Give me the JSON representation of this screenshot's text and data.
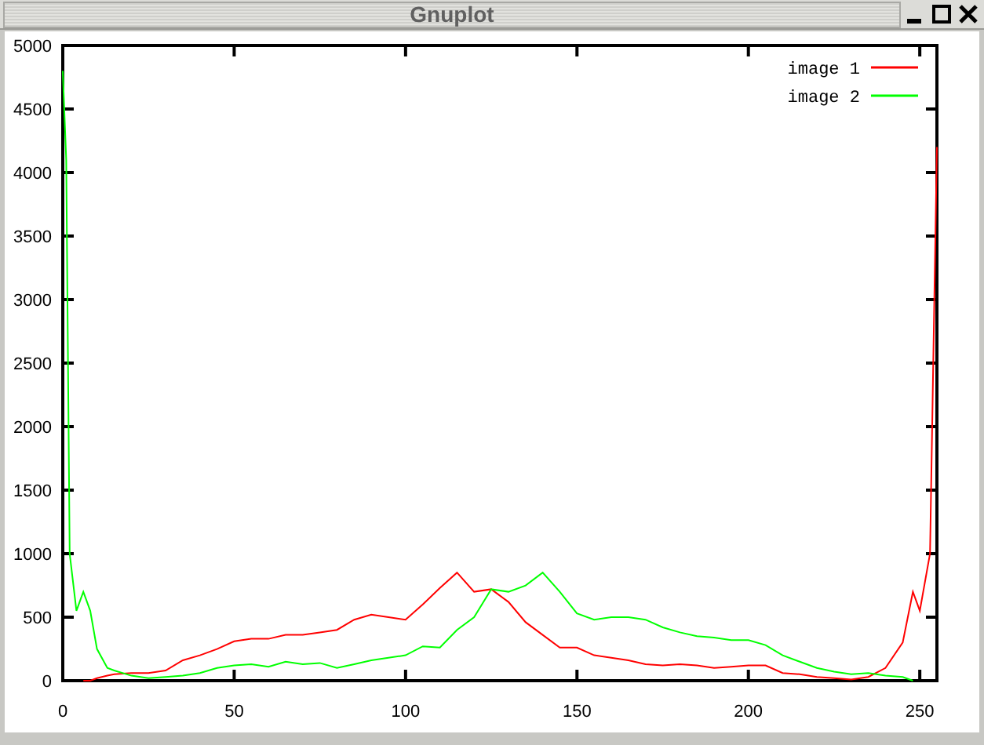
{
  "window": {
    "title": "Gnuplot"
  },
  "chart": {
    "chart_data": {
      "type": "line",
      "legend": "top right",
      "xlim": [
        0,
        255
      ],
      "ylim": [
        0,
        5000
      ],
      "xticks": [
        0,
        50,
        100,
        150,
        200,
        250
      ],
      "yticks": [
        0,
        500,
        1000,
        1500,
        2000,
        2500,
        3000,
        3500,
        4000,
        4500,
        5000
      ],
      "x": [
        0,
        1,
        2,
        4,
        6,
        8,
        10,
        13,
        15,
        20,
        25,
        30,
        35,
        40,
        45,
        50,
        55,
        60,
        65,
        70,
        75,
        80,
        85,
        90,
        95,
        100,
        105,
        110,
        115,
        120,
        125,
        130,
        135,
        140,
        145,
        150,
        155,
        160,
        165,
        170,
        175,
        180,
        185,
        190,
        195,
        200,
        205,
        210,
        215,
        220,
        225,
        230,
        235,
        240,
        245,
        248,
        250,
        253,
        255
      ],
      "series": [
        {
          "name": "image 1",
          "color": "#ff0000",
          "values": [
            null,
            null,
            null,
            null,
            0,
            0,
            20,
            40,
            50,
            60,
            60,
            80,
            160,
            200,
            250,
            310,
            330,
            330,
            360,
            360,
            380,
            400,
            480,
            520,
            500,
            480,
            600,
            730,
            850,
            700,
            720,
            620,
            460,
            360,
            260,
            260,
            200,
            180,
            160,
            130,
            120,
            130,
            120,
            100,
            110,
            120,
            120,
            60,
            50,
            30,
            20,
            10,
            30,
            100,
            300,
            700,
            550,
            1000,
            4200
          ]
        },
        {
          "name": "image 2",
          "color": "#00ff00",
          "values": [
            4800,
            4100,
            1000,
            550,
            700,
            550,
            250,
            100,
            80,
            40,
            20,
            30,
            40,
            60,
            100,
            120,
            130,
            110,
            150,
            130,
            140,
            100,
            130,
            160,
            180,
            200,
            270,
            260,
            400,
            500,
            720,
            700,
            750,
            850,
            700,
            530,
            480,
            500,
            500,
            480,
            420,
            380,
            350,
            340,
            320,
            320,
            280,
            200,
            150,
            100,
            70,
            50,
            60,
            40,
            30,
            0,
            null,
            null,
            null
          ]
        }
      ]
    }
  }
}
